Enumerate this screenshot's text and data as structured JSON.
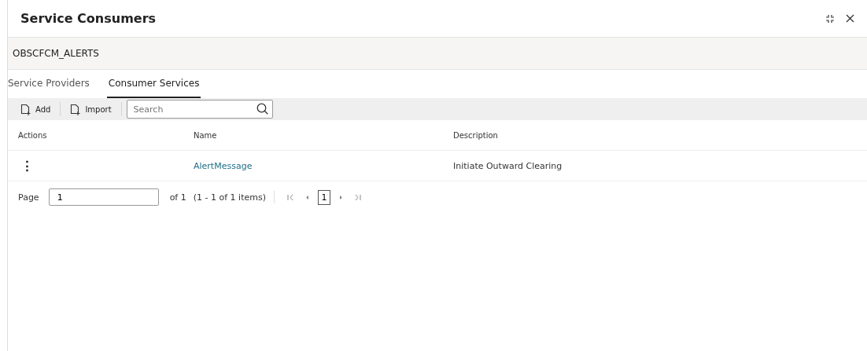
{
  "window": {
    "title": "Service Consumers"
  },
  "record": {
    "name": "OBSCFCM_ALERTS"
  },
  "tabs": [
    {
      "label": "Service Providers",
      "selected": false
    },
    {
      "label": "Consumer Services",
      "selected": true
    }
  ],
  "toolbar": {
    "buttons": [
      "Add",
      "Import"
    ],
    "search": {
      "placeholder": "Search"
    }
  },
  "table": {
    "columns": [
      "Actions",
      "Name",
      "Description"
    ],
    "rows": [
      {
        "actions": "⋮",
        "name": "AlertMessage",
        "description": "Initiate Outward Clearing"
      }
    ]
  },
  "pager": {
    "label": "Page",
    "page": "1",
    "of": "of 1",
    "items": "(1 - 1 of 1 items)",
    "pages": [
      {
        "label": "1",
        "selected": true
      }
    ]
  }
}
